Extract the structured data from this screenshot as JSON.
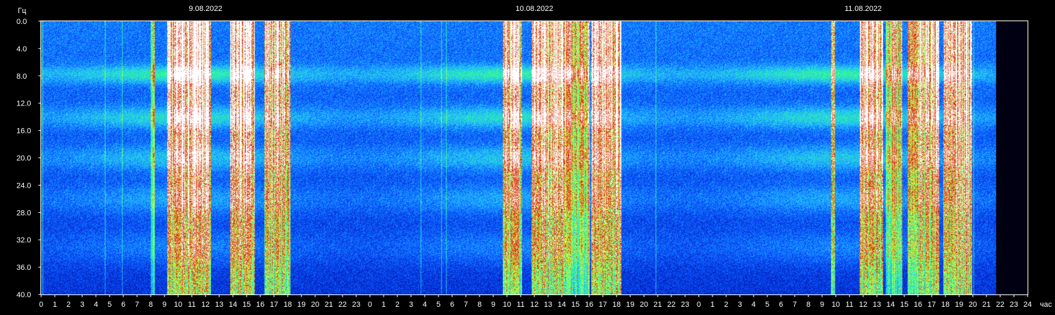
{
  "chart_data": {
    "type": "heatmap",
    "title": "",
    "xlabel": "час",
    "ylabel": "Гц",
    "ylim": [
      0,
      40
    ],
    "y_ticks": [
      "0.0",
      "4.0",
      "8.0",
      "12.0",
      "16.0",
      "20.0",
      "24.0",
      "28.0",
      "32.0",
      "36.0",
      "40.0"
    ],
    "x_ticks": [
      "0",
      "1",
      "2",
      "3",
      "4",
      "5",
      "6",
      "7",
      "8",
      "9",
      "10",
      "11",
      "12",
      "13",
      "14",
      "15",
      "16",
      "17",
      "18",
      "19",
      "20",
      "21",
      "22",
      "23",
      "0",
      "1",
      "2",
      "3",
      "4",
      "5",
      "6",
      "7",
      "8",
      "9",
      "10",
      "11",
      "12",
      "13",
      "14",
      "15",
      "16",
      "17",
      "18",
      "19",
      "20",
      "21",
      "22",
      "23",
      "0",
      "1",
      "2",
      "3",
      "4",
      "5",
      "6",
      "7",
      "8",
      "9",
      "10",
      "11",
      "12",
      "13",
      "14",
      "15",
      "16",
      "17",
      "18",
      "19",
      "20",
      "21",
      "22",
      "23",
      "24"
    ],
    "x_range_hours": [
      0,
      72
    ],
    "data_end_hour": 69.6,
    "date_labels": [
      {
        "label": "9.08.2022",
        "hour": 12
      },
      {
        "label": "10.08.2022",
        "hour": 36
      },
      {
        "label": "11.08.2022",
        "hour": 60
      }
    ],
    "resonance_bands_hz": [
      7.8,
      14.1,
      20.0,
      26.0,
      33.0
    ],
    "bursts": [
      {
        "start_hour": 9.2,
        "end_hour": 12.4,
        "level": 1.0
      },
      {
        "start_hour": 13.8,
        "end_hour": 15.6,
        "level": 1.0
      },
      {
        "start_hour": 16.3,
        "end_hour": 18.2,
        "level": 0.9
      },
      {
        "start_hour": 8.0,
        "end_hour": 8.3,
        "level": 0.5
      },
      {
        "start_hour": 33.7,
        "end_hour": 35.1,
        "level": 0.85
      },
      {
        "start_hour": 35.8,
        "end_hour": 38.3,
        "level": 1.0
      },
      {
        "start_hour": 38.3,
        "end_hour": 40.0,
        "level": 0.75
      },
      {
        "start_hour": 40.1,
        "end_hour": 42.3,
        "level": 1.0
      },
      {
        "start_hour": 57.6,
        "end_hour": 57.9,
        "level": 0.8
      },
      {
        "start_hour": 59.7,
        "end_hour": 61.4,
        "level": 0.9
      },
      {
        "start_hour": 61.6,
        "end_hour": 62.8,
        "level": 0.7
      },
      {
        "start_hour": 63.2,
        "end_hour": 65.5,
        "level": 0.85
      },
      {
        "start_hour": 65.8,
        "end_hour": 67.9,
        "level": 1.0
      }
    ],
    "colormap": [
      "#000033",
      "#0010a0",
      "#0a50ff",
      "#22c0ff",
      "#30ff90",
      "#e0ff40",
      "#d01000",
      "#ffffff"
    ],
    "axis_color": "#ffffff",
    "background": "#000000"
  }
}
